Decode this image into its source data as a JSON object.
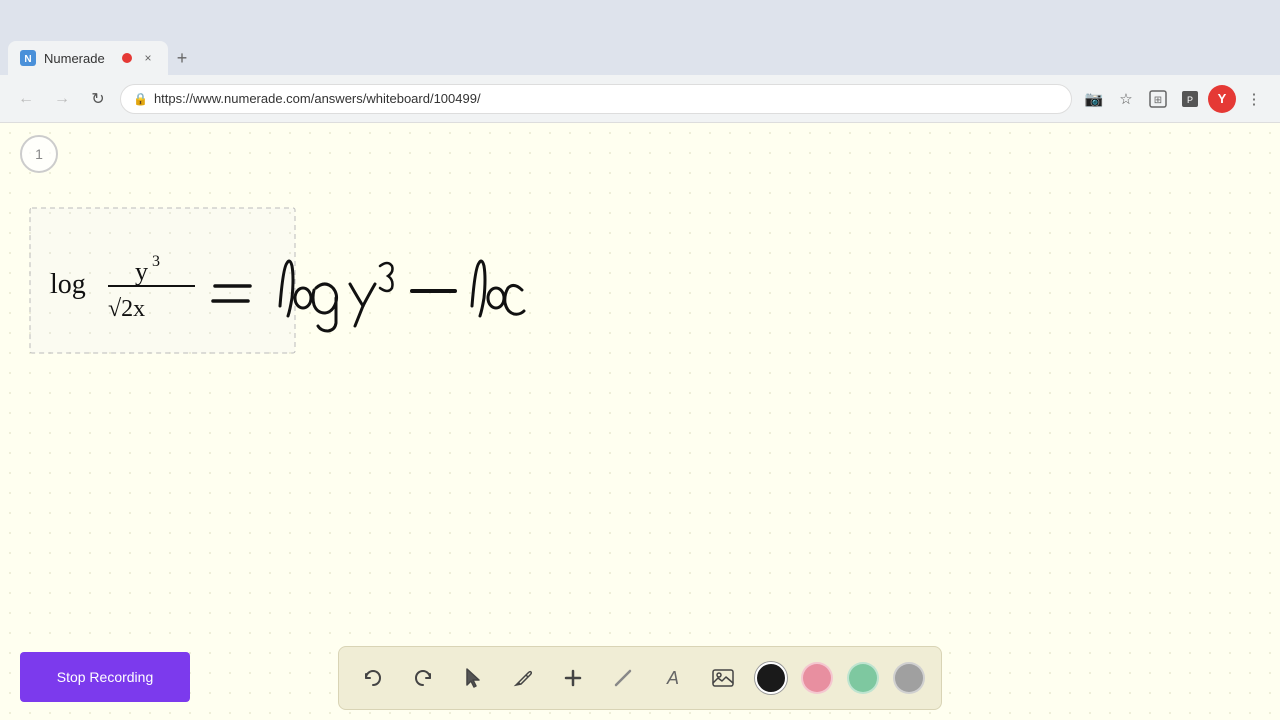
{
  "browser": {
    "tab": {
      "title": "Numerade",
      "favicon": "N",
      "recording_dot": true,
      "close": "×"
    },
    "new_tab": "+",
    "nav": {
      "back": "←",
      "forward": "→",
      "reload": "↻",
      "url": "https://www.numerade.com/answers/whiteboard/100499/",
      "lock": "🔒"
    },
    "actions": {
      "camera": "📷",
      "star": "☆",
      "extension1": "⬡",
      "extension2": "⬡",
      "user": "Y",
      "menu": "⋮"
    }
  },
  "whiteboard": {
    "page_number": "1",
    "math_expression": "log y³/√2x = log y³ — loc"
  },
  "toolbar": {
    "tools": [
      {
        "name": "undo",
        "icon": "↩",
        "label": "Undo"
      },
      {
        "name": "redo",
        "icon": "↪",
        "label": "Redo"
      },
      {
        "name": "select",
        "icon": "▶",
        "label": "Select"
      },
      {
        "name": "pen",
        "icon": "✏",
        "label": "Pen"
      },
      {
        "name": "add",
        "icon": "+",
        "label": "Add"
      },
      {
        "name": "eraser",
        "icon": "/",
        "label": "Eraser"
      },
      {
        "name": "text",
        "icon": "A",
        "label": "Text"
      },
      {
        "name": "image",
        "icon": "🖼",
        "label": "Image"
      }
    ],
    "colors": [
      {
        "name": "black",
        "value": "#1a1a1a"
      },
      {
        "name": "pink",
        "value": "#e88fa0"
      },
      {
        "name": "green",
        "value": "#7ec8a0"
      },
      {
        "name": "gray",
        "value": "#a0a0a0"
      }
    ]
  },
  "stop_recording_button": {
    "label": "Stop Recording"
  }
}
